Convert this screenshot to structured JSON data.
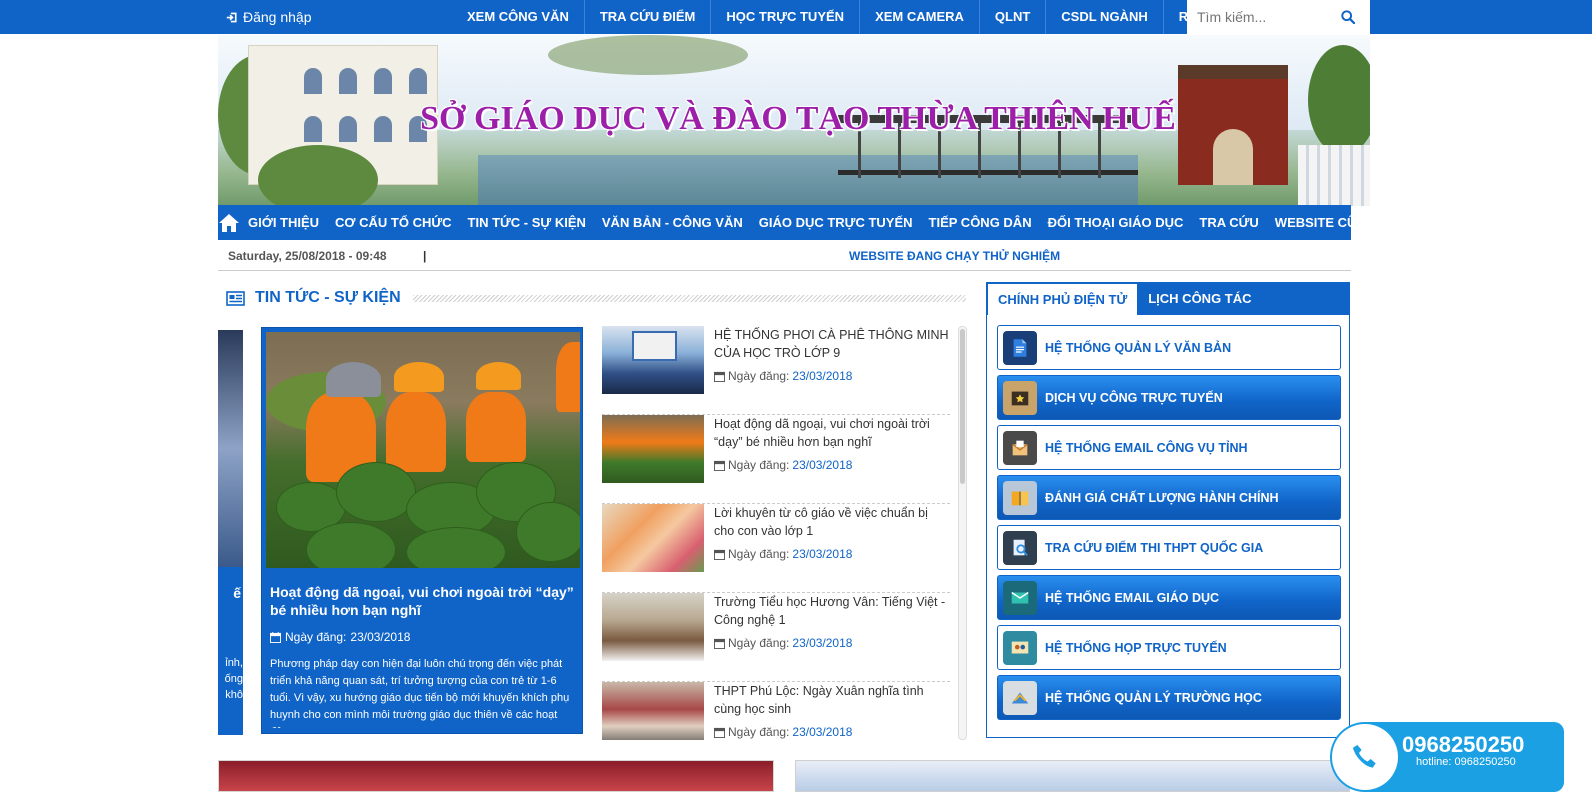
{
  "topbar": {
    "login_label": "Đăng nhập",
    "nav": [
      "XEM CÔNG VĂN",
      "TRA CỨU ĐIỂM",
      "HỌC TRỰC TUYẾN",
      "XEM CAMERA",
      "QLNT",
      "CSDL NGÀNH",
      "RSS"
    ],
    "search_placeholder": "Tìm kiếm..."
  },
  "banner": {
    "title": "SỞ GIÁO DỤC VÀ ĐÀO TẠO  THỪA THIÊN HUẾ"
  },
  "mainnav": [
    "GIỚI THIỆU",
    "CƠ CẤU TỔ CHỨC",
    "TIN TỨC - SỰ KIỆN",
    "VĂN BẢN - CÔNG VĂN",
    "GIÁO DỤC TRỰC TUYẾN",
    "TIẾP CÔNG DÂN",
    "ĐỐI THOẠI GIÁO DỤC",
    "TRA CỨU",
    "WEBSITE CŨ"
  ],
  "infobar": {
    "datetime": "Saturday, 25/08/2018 - 09:48",
    "separator": "|",
    "notice": "WEBSITE ĐANG CHẠY THỬ NGHIỆM"
  },
  "news_section": {
    "title": "TIN TỨC - SỰ KIỆN",
    "slider_prev_text": "ỉnh,\nống\nkhô",
    "slider_prev_letter": "ế",
    "featured": {
      "title": "Hoạt động dã ngoại, vui chơi ngoài trời “dạy” bé nhiều hơn bạn nghĩ",
      "date_label": "Ngày đăng:",
      "date": "23/03/2018",
      "summary": "Phương pháp dạy con hiện đại luôn chú trọng đến việc phát triển khả năng quan sát, trí tưởng tượng của con trẻ từ 1-6 tuổi. Vì vậy, xu hướng giáo dục tiến bộ mới khuyến khích phụ huynh cho con mình môi trường giáo dục thiên về các hoạt động"
    },
    "items": [
      {
        "title": "HỆ THỐNG PHƠI CÀ PHÊ THÔNG MINH CỦA HỌC TRÒ LỚP 9",
        "date_label": "Ngày đăng:",
        "date": "23/03/2018"
      },
      {
        "title": "Hoạt động dã ngoại, vui chơi ngoài trời “dạy” bé nhiều hơn bạn nghĩ",
        "date_label": "Ngày đăng:",
        "date": "23/03/2018"
      },
      {
        "title": "Lời khuyên từ cô giáo về việc chuẩn bị cho con vào lớp 1",
        "date_label": "Ngày đăng:",
        "date": "23/03/2018"
      },
      {
        "title": "Trường Tiểu học Hương Vân: Tiếng Việt - Công nghệ 1",
        "date_label": "Ngày đăng:",
        "date": "23/03/2018"
      },
      {
        "title": "THPT Phú Lộc: Ngày Xuân nghĩa tình cùng học sinh",
        "date_label": "Ngày đăng:",
        "date": "23/03/2018"
      }
    ]
  },
  "sidebar": {
    "tabs": [
      "CHÍNH PHỦ ĐIỆN TỬ",
      "LỊCH CÔNG TÁC"
    ],
    "links": [
      "HỆ THỐNG QUẢN LÝ VĂN BẢN",
      "DỊCH VỤ CÔNG TRỰC TUYẾN",
      "HỆ THỐNG EMAIL CÔNG VỤ TỈNH",
      "ĐÁNH GIÁ CHẤT LƯỢNG HÀNH CHÍNH",
      "TRA CỨU ĐIỂM THI THPT QUỐC GIA",
      "HỆ THỐNG EMAIL GIÁO DỤC",
      "HỆ THỐNG HỌP TRỰC TUYẾN",
      "HỆ THỐNG QUẢN LÝ TRƯỜNG HỌC"
    ],
    "link_icons": [
      "document-icon",
      "star-folder-icon",
      "email-icon",
      "book-icon",
      "search-document-icon",
      "email-screen-icon",
      "video-conference-icon",
      "school-management-icon"
    ]
  },
  "hotline": {
    "number": "0968250250",
    "sub": "hotline: 0968250250"
  },
  "colors": {
    "primary": "#1064c8",
    "banner_title": "#9b1fa8",
    "hotline": "#1ba0e3"
  }
}
